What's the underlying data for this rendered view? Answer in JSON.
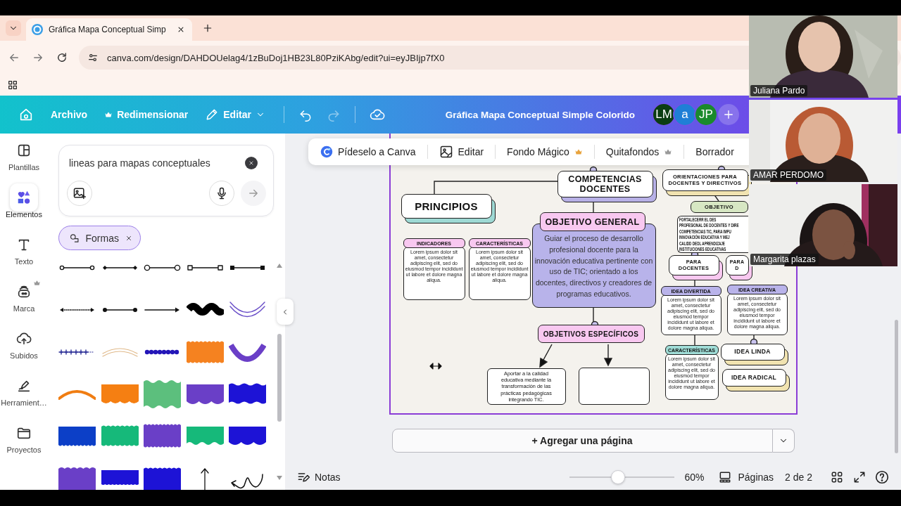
{
  "browser": {
    "tab": {
      "title": "Gráfica Mapa Conceptual Simp"
    },
    "url": "canva.com/design/DAHDOUelag4/1zBuDoj1HB23L80PziKAbg/edit?ui=eyJBIjp7fX0"
  },
  "header": {
    "menu": [
      {
        "label": "Archivo",
        "kind": "plain"
      },
      {
        "label": "Redimensionar",
        "kind": "premium"
      },
      {
        "label": "Editar",
        "kind": "dropdown"
      }
    ],
    "history": [
      {
        "kind": "undo",
        "disabled": false
      },
      {
        "kind": "redo",
        "disabled": true
      }
    ],
    "title": "Gráfica Mapa Conceptual Simple Colorido",
    "collaborators": [
      {
        "initials": "LM",
        "color": "#0b3d12"
      },
      {
        "initials": "a",
        "color": "#1f7fd6"
      },
      {
        "initials": "JP",
        "color": "#1a8a2c"
      }
    ]
  },
  "sidebar": {
    "items": [
      {
        "label": "Plantillas",
        "selected": false,
        "premium": false
      },
      {
        "label": "Elementos",
        "selected": true,
        "premium": false
      },
      {
        "label": "Texto",
        "selected": false,
        "premium": false
      },
      {
        "label": "Marca",
        "selected": false,
        "premium": true
      },
      {
        "label": "Subidos",
        "selected": false,
        "premium": false
      },
      {
        "label": "Herramient…",
        "selected": false,
        "premium": false
      },
      {
        "label": "Proyectos",
        "selected": false,
        "premium": false
      }
    ]
  },
  "panel": {
    "search": {
      "value": "lineas para mapas conceptuales"
    },
    "filter": {
      "label": "Formas"
    }
  },
  "toolbar": {
    "items": [
      {
        "label": "Pídeselo a Canva",
        "kind": "ai"
      },
      {
        "label": "Editar",
        "kind": "edit"
      },
      {
        "label": "Fondo Mágico",
        "kind": "premium",
        "color": "#e8a33d"
      },
      {
        "label": "Quitafondos",
        "kind": "premium",
        "color": "#9a9a9a"
      },
      {
        "label": "Borrador",
        "kind": "plain"
      }
    ]
  },
  "diagram": {
    "nodes": [
      {
        "kind": "title",
        "text": "COMPETENCIAS DOCENTES",
        "color": "#b7b0e6"
      },
      {
        "kind": "title",
        "text": "ORIENTACIONES PARA DOCENTES Y DIRECTIVOS",
        "color": "#f1e3b0"
      },
      {
        "kind": "title",
        "text": "PRINCIPIOS",
        "color": "#9ed9d4"
      },
      {
        "kind": "panel",
        "title": "OBJETIVO GENERAL",
        "text": "Guiar el proceso de desarrollo profesional docente para la innovación educativa pertinente con uso de TIC; orientado a los docentes, directivos y creadores de programas educativos.",
        "color": "#b8b3ea"
      },
      {
        "kind": "label",
        "text": "OBJETIVOS ESPECÍFICOS",
        "color": "#f8c8f0"
      },
      {
        "kind": "box",
        "text": "Aportar a la calidad educativa mediante la transformación de las prácticas pedagógicas integrando TIC."
      },
      {
        "kind": "empty_box"
      },
      {
        "kind": "card",
        "title": "INDICADORES",
        "text": "Lorem ipsum dolor sit amet, consectetur adipiscing elit, sed do eiusmod tempor incididunt ut labore et dolore magna aliqua.",
        "color": "#f8c8f0"
      },
      {
        "kind": "card",
        "title": "CARACTERÍSTICAS",
        "text": "Lorem ipsum dolor sit amet, consectetur adipiscing elit, sed do eiusmod tempor incididunt ut labore et dolore magna aliqua.",
        "color": "#f8c8f0"
      },
      {
        "kind": "label",
        "text": "OBJETIVO",
        "color": "#d7e7c3"
      },
      {
        "kind": "box",
        "text": "FORTALECERR EL DES\nPROFESIONAL DE DOCENTES Y DIRE\nCOMPETENCIAS TIC, PARA IMPU\nINNOVACIÓN EDUCATIVA Y MEJ\nCALIDD DEDL APRENDIZAJE\nINSTITUCIONES EDUCATIVAS"
      },
      {
        "kind": "title",
        "text": "PARA DOCENTES",
        "color": "#f8c8f0"
      },
      {
        "kind": "title",
        "text": "PARA D",
        "color": "#f8c8f0"
      },
      {
        "kind": "card",
        "title": "IDEA DIVERTIDA",
        "text": "Lorem ipsum dolor sit amet, consectetur adipiscing elit, sed do eiusmod tempor incididunt ut labore et dolore magna aliqua.",
        "color": "#b9b3ea"
      },
      {
        "kind": "card",
        "title": "IDEA CREATIVA",
        "text": "Lorem ipsum dolor sit amet, consectetur adipiscing elit, sed do eiusmod tempor incididunt ut labore et dolore magna aliqua.",
        "color": "#b9b3ea"
      },
      {
        "kind": "card",
        "title": "CARACTERÍSTICAS",
        "text": "Lorem ipsum dolor sit amet, consectetur adipiscing elit, sed do eiusmod tempor incididunt ut labore et dolore magna aliqua.",
        "color": "#9fdcd6"
      },
      {
        "kind": "title",
        "text": "IDEA LINDA",
        "color": "#f1e3b0"
      },
      {
        "kind": "title",
        "text": "IDEA RADICAL",
        "color": "#f1e3b0"
      }
    ]
  },
  "add_page": {
    "label": "+ Agregar una página"
  },
  "footer": {
    "notes": "Notas",
    "zoom": {
      "level": 0.46,
      "reading": "60%"
    },
    "pages": "Páginas",
    "page_indicator": "2 de 2"
  },
  "participants": [
    {
      "name": "Juliana Pardo"
    },
    {
      "name": "AMAR PERDOMO"
    },
    {
      "name": "Margarita plazas"
    }
  ]
}
